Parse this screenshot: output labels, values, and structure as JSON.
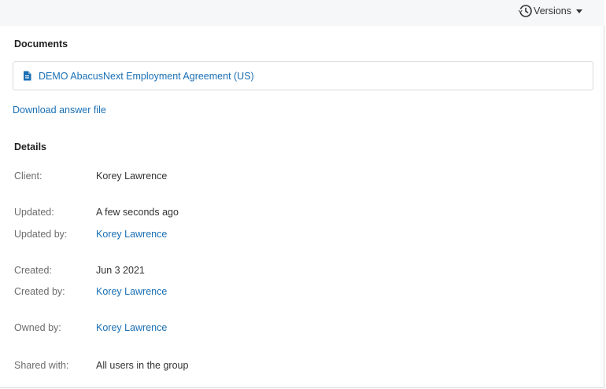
{
  "header": {
    "versions_label": "Versions"
  },
  "documents": {
    "title": "Documents",
    "items": [
      {
        "label": "DEMO AbacusNext Employment Agreement (US)"
      }
    ]
  },
  "download_link": "Download answer file",
  "details": {
    "title": "Details",
    "rows": [
      {
        "label": "Client:",
        "value": "Korey Lawrence",
        "is_link": false
      },
      {
        "label": "Updated:",
        "value": "A few seconds ago",
        "is_link": false
      },
      {
        "label": "Updated by:",
        "value": "Korey Lawrence",
        "is_link": true
      },
      {
        "label": "Created:",
        "value": "Jun 3 2021",
        "is_link": false
      },
      {
        "label": "Created by:",
        "value": "Korey Lawrence",
        "is_link": true
      },
      {
        "label": "Owned by:",
        "value": "Korey Lawrence",
        "is_link": true
      },
      {
        "label": "Shared with:",
        "value": "All users in the group",
        "is_link": false
      }
    ]
  },
  "colors": {
    "link": "#1a6fb4",
    "topbar_bg": "#f6f7f8",
    "label_gray": "#6b6b6b"
  },
  "icons": {
    "versions": "history-icon",
    "document": "document-icon",
    "caret": "caret-down-icon"
  }
}
